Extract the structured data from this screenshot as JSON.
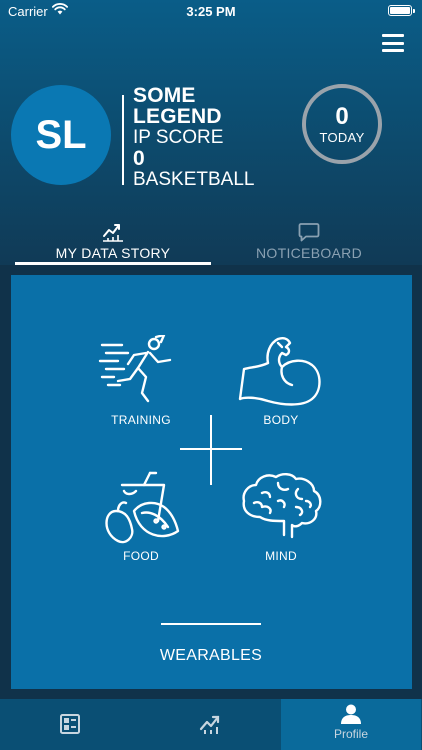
{
  "status_bar": {
    "carrier": "Carrier",
    "time": "3:25 PM"
  },
  "profile": {
    "initials": "SL",
    "name_line1": "SOME",
    "name_line2": "LEGEND",
    "score_label": "IP SCORE",
    "score_value": "0",
    "sport": "BASKETBALL"
  },
  "today": {
    "count": "0",
    "label": "TODAY"
  },
  "tabs": [
    {
      "label": "MY DATA STORY",
      "icon": "chart-icon",
      "active": true
    },
    {
      "label": "NOTICEBOARD",
      "icon": "chat-icon",
      "active": false
    }
  ],
  "categories": {
    "training": {
      "label": "TRAINING",
      "icon": "runner-icon"
    },
    "body": {
      "label": "BODY",
      "icon": "flexed-bicep-icon"
    },
    "food": {
      "label": "FOOD",
      "icon": "fruit-drink-icon"
    },
    "mind": {
      "label": "MIND",
      "icon": "brain-icon"
    }
  },
  "wearables": {
    "label": "WEARABLES"
  },
  "bottom_nav": [
    {
      "label": "",
      "icon": "dashboard-icon"
    },
    {
      "label": "",
      "icon": "chart-icon"
    },
    {
      "label": "Profile",
      "icon": "person-icon",
      "active": true
    }
  ],
  "colors": {
    "header_top": "#0a5d88",
    "content_panel": "#0a70a8",
    "avatar": "#0a78b3",
    "bottom_nav": "#0a4f74",
    "today_ring": "#9aa3ab"
  }
}
